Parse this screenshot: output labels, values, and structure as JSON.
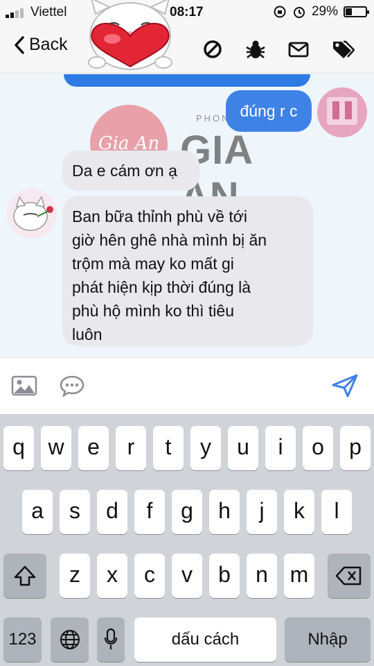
{
  "status_bar": {
    "carrier": "Viettel",
    "time": "08:17",
    "battery": "29%"
  },
  "nav": {
    "back_label": "Back"
  },
  "watermark": {
    "logo_text": "Gia An",
    "brand_small": "PHONG THỦY",
    "brand": "GIA AN"
  },
  "messages": [
    {
      "from": "me",
      "text": "đúng r c"
    },
    {
      "from": "other",
      "text": "Da e cám ơn ạ"
    },
    {
      "from": "other",
      "lines": [
        "Ban bữa thỉnh phù về tới",
        "giờ hên ghê nhà mình bị ăn",
        "trộm mà may ko mất gi",
        "phát hiện kịp thời đúng là",
        "phù hộ mình ko thì tiêu",
        "luôn"
      ]
    }
  ],
  "composer": {
    "placeholder": ""
  },
  "keyboard": {
    "row1": [
      "q",
      "w",
      "e",
      "r",
      "t",
      "y",
      "u",
      "i",
      "o",
      "p"
    ],
    "row2": [
      "a",
      "s",
      "d",
      "f",
      "g",
      "h",
      "j",
      "k",
      "l"
    ],
    "row3": [
      "z",
      "x",
      "c",
      "v",
      "b",
      "n",
      "m"
    ],
    "numbers_label": "123",
    "space_label": "dấu cách",
    "return_label": "Nhập"
  },
  "colors": {
    "accent": "#3f82e6",
    "incoming_bubble": "#e8e8ed",
    "chat_background": "#eef6fc",
    "keyboard_background": "#d0d3d8"
  },
  "icons": [
    "back-chevron-icon",
    "block-icon",
    "bug-icon",
    "mail-icon",
    "tags-icon",
    "image-icon",
    "chat-bubble-icon",
    "send-icon",
    "shift-icon",
    "delete-icon",
    "globe-icon",
    "microphone-icon"
  ]
}
